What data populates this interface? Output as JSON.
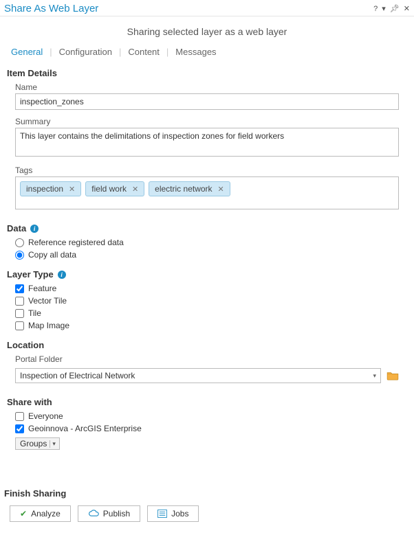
{
  "window": {
    "title": "Share As Web Layer"
  },
  "subtitle": "Sharing selected layer as a web layer",
  "tabs": [
    "General",
    "Configuration",
    "Content",
    "Messages"
  ],
  "active_tab": 0,
  "item_details": {
    "heading": "Item Details",
    "name_label": "Name",
    "name_value": "inspection_zones",
    "summary_label": "Summary",
    "summary_value": "This layer contains the delimitations of inspection zones for field workers",
    "tags_label": "Tags",
    "tags": [
      "inspection",
      "field work",
      "electric network"
    ]
  },
  "data": {
    "heading": "Data",
    "options": [
      "Reference registered data",
      "Copy all data"
    ],
    "selected_index": 1
  },
  "layer_type": {
    "heading": "Layer Type",
    "options": [
      {
        "label": "Feature",
        "checked": true
      },
      {
        "label": "Vector Tile",
        "checked": false
      },
      {
        "label": "Tile",
        "checked": false
      },
      {
        "label": "Map Image",
        "checked": false
      }
    ]
  },
  "location": {
    "heading": "Location",
    "folder_label": "Portal Folder",
    "folder_value": "Inspection of Electrical Network"
  },
  "share_with": {
    "heading": "Share with",
    "options": [
      {
        "label": "Everyone",
        "checked": false
      },
      {
        "label": "Geoinnova - ArcGIS Enterprise",
        "checked": true
      }
    ],
    "groups_label": "Groups"
  },
  "finish": {
    "heading": "Finish Sharing",
    "analyze": "Analyze",
    "publish": "Publish",
    "jobs": "Jobs"
  }
}
